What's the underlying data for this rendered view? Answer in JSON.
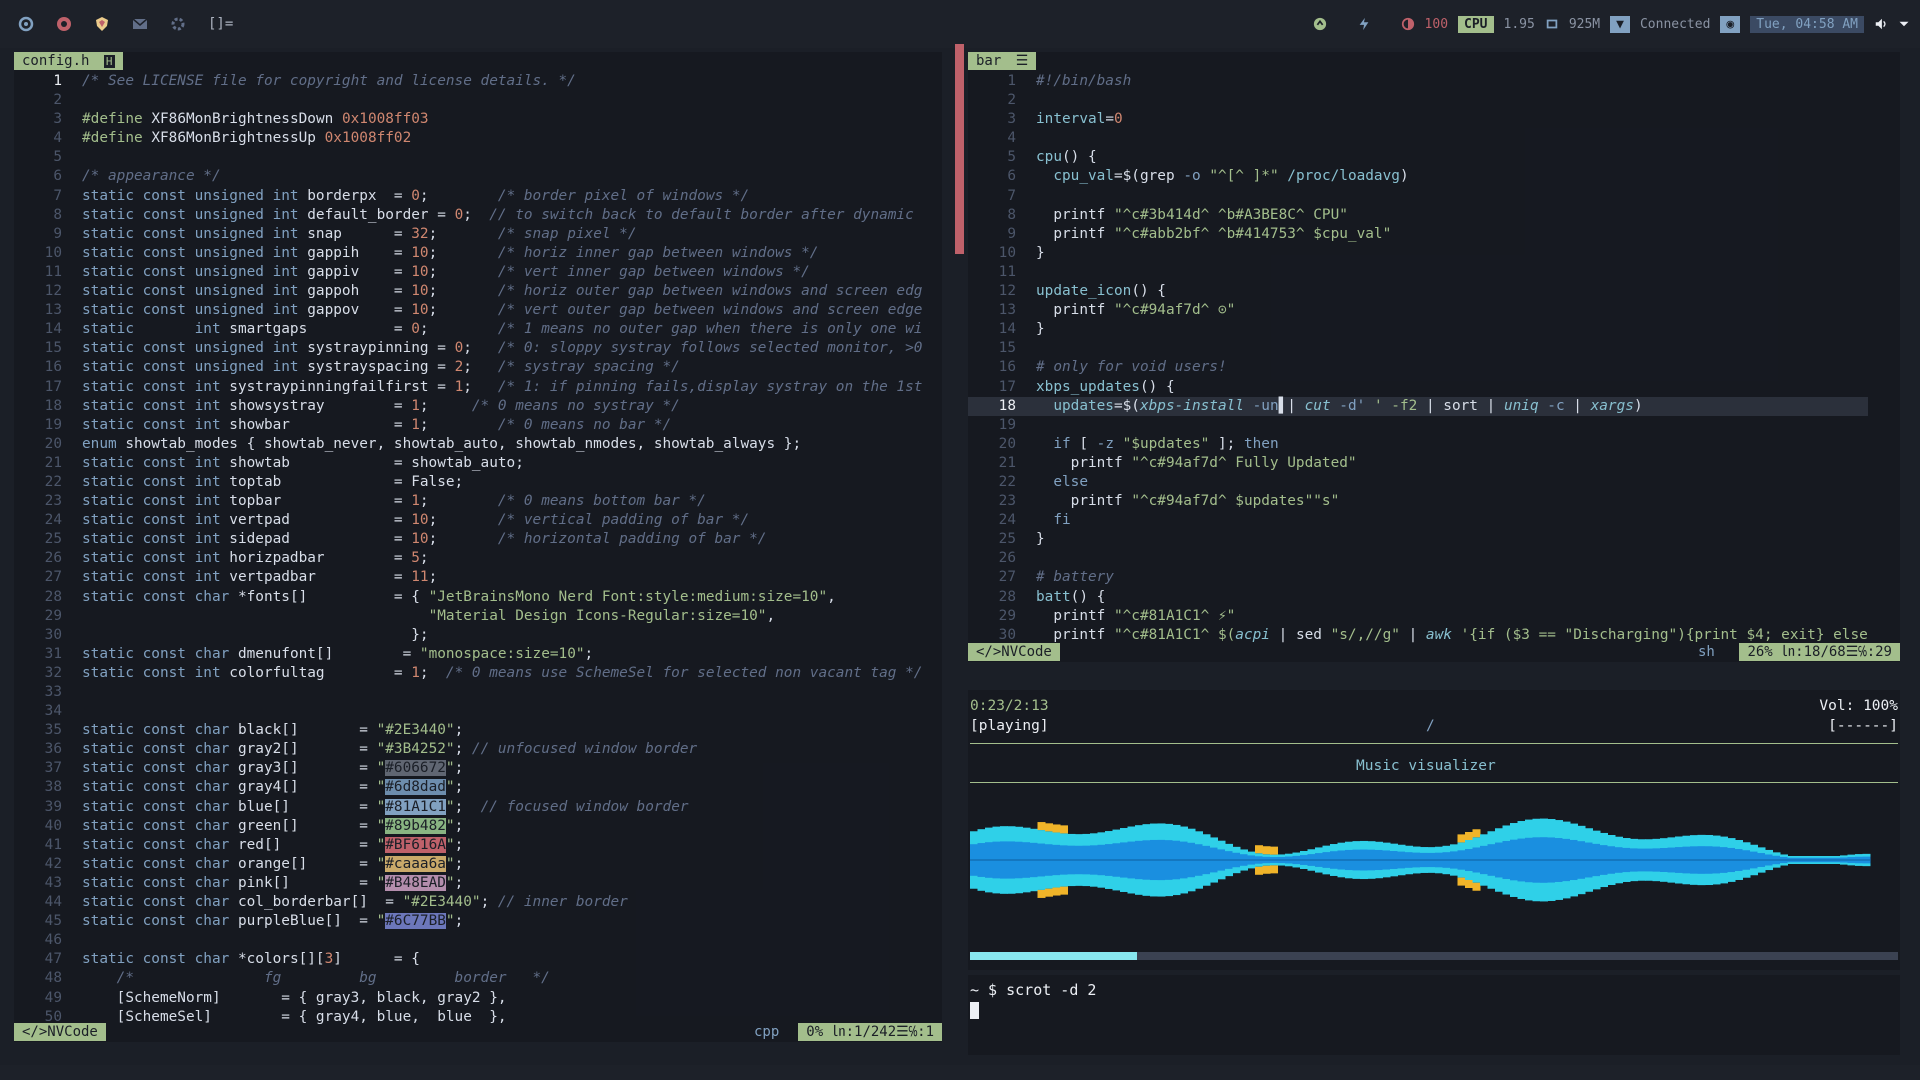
{
  "topbar": {
    "cpu_label": "CPU",
    "cpu_value": "1.95",
    "mem_value": "925M",
    "brightness_value": "100",
    "wifi_status": "Connected",
    "datetime": "Tue, 04:58 AM",
    "bracket": "[]="
  },
  "left_editor": {
    "tab": "config.h",
    "status_mode": "</>NVCode",
    "filetype": "cpp",
    "position": "0% ㏑:1/242☰℅:1",
    "lines": [
      {
        "n": "1",
        "html": "<span class='cm'>/* See LICENSE file for copyright and license details. */</span>"
      },
      {
        "n": "2",
        "html": ""
      },
      {
        "n": "3",
        "html": "<span class='pp'>#define</span> <span class='id'>XF86MonBrightnessDown</span> <span class='num'>0x1008ff03</span>"
      },
      {
        "n": "4",
        "html": "<span class='pp'>#define</span> <span class='id'>XF86MonBrightnessUp</span> <span class='num'>0x1008ff02</span>"
      },
      {
        "n": "5",
        "html": ""
      },
      {
        "n": "6",
        "html": "<span class='cm'>/* appearance */</span>"
      },
      {
        "n": "7",
        "html": "<span class='kw'>static const unsigned int</span> borderpx  = <span class='num'>0</span>;        <span class='cm'>/* border pixel of windows */</span>"
      },
      {
        "n": "8",
        "html": "<span class='kw'>static const unsigned int</span> default_border = <span class='num'>0</span>;  <span class='cm'>// to switch back to default border after dynamic</span>"
      },
      {
        "n": "9",
        "html": "<span class='kw'>static const unsigned int</span> snap      = <span class='num'>32</span>;       <span class='cm'>/* snap pixel */</span>"
      },
      {
        "n": "10",
        "html": "<span class='kw'>static const unsigned int</span> gappih    = <span class='num'>10</span>;       <span class='cm'>/* horiz inner gap between windows */</span>"
      },
      {
        "n": "11",
        "html": "<span class='kw'>static const unsigned int</span> gappiv    = <span class='num'>10</span>;       <span class='cm'>/* vert inner gap between windows */</span>"
      },
      {
        "n": "12",
        "html": "<span class='kw'>static const unsigned int</span> gappoh    = <span class='num'>10</span>;       <span class='cm'>/* horiz outer gap between windows and screen edg</span>"
      },
      {
        "n": "13",
        "html": "<span class='kw'>static const unsigned int</span> gappov    = <span class='num'>10</span>;       <span class='cm'>/* vert outer gap between windows and screen edge</span>"
      },
      {
        "n": "14",
        "html": "<span class='kw'>static       int</span> smartgaps          = <span class='num'>0</span>;        <span class='cm'>/* 1 means no outer gap when there is only one wi</span>"
      },
      {
        "n": "15",
        "html": "<span class='kw'>static const unsigned int</span> systraypinning = <span class='num'>0</span>;   <span class='cm'>/* 0: sloppy systray follows selected monitor, >0</span>"
      },
      {
        "n": "16",
        "html": "<span class='kw'>static const unsigned int</span> systrayspacing = <span class='num'>2</span>;   <span class='cm'>/* systray spacing */</span>"
      },
      {
        "n": "17",
        "html": "<span class='kw'>static const int</span> systraypinningfailfirst = <span class='num'>1</span>;   <span class='cm'>/* 1: if pinning fails,display systray on the 1st</span>"
      },
      {
        "n": "18",
        "html": "<span class='kw'>static const int</span> showsystray        = <span class='num'>1</span>;     <span class='cm'>/* 0 means no systray */</span>"
      },
      {
        "n": "19",
        "html": "<span class='kw'>static const int</span> showbar            = <span class='num'>1</span>;        <span class='cm'>/* 0 means no bar */</span>"
      },
      {
        "n": "20",
        "html": "<span class='kw'>enum</span> showtab_modes { showtab_never, showtab_auto, showtab_nmodes, showtab_always };"
      },
      {
        "n": "21",
        "html": "<span class='kw'>static const int</span> showtab            = showtab_auto;"
      },
      {
        "n": "22",
        "html": "<span class='kw'>static const int</span> toptab             = False;"
      },
      {
        "n": "23",
        "html": "<span class='kw'>static const int</span> topbar             = <span class='num'>1</span>;        <span class='cm'>/* 0 means bottom bar */</span>"
      },
      {
        "n": "24",
        "html": "<span class='kw'>static const int</span> vertpad            = <span class='num'>10</span>;       <span class='cm'>/* vertical padding of bar */</span>"
      },
      {
        "n": "25",
        "html": "<span class='kw'>static const int</span> sidepad            = <span class='num'>10</span>;       <span class='cm'>/* horizontal padding of bar */</span>"
      },
      {
        "n": "26",
        "html": "<span class='kw'>static const int</span> horizpadbar        = <span class='num'>5</span>;"
      },
      {
        "n": "27",
        "html": "<span class='kw'>static const int</span> vertpadbar         = <span class='num'>11</span>;"
      },
      {
        "n": "28",
        "html": "<span class='kw'>static const char</span> *fonts[]          = { <span class='str'>\"JetBrainsMono Nerd Font:style:medium:size=10\"</span>,"
      },
      {
        "n": "29",
        "html": "                                        <span class='str'>\"Material Design Icons-Regular:size=10\"</span>,"
      },
      {
        "n": "30",
        "html": "                                      };"
      },
      {
        "n": "31",
        "html": "<span class='kw'>static const char</span> dmenufont[]        = <span class='str'>\"monospace:size=10\"</span>;"
      },
      {
        "n": "32",
        "html": "<span class='kw'>static const int</span> colorfultag        = <span class='num'>1</span>;  <span class='cm'>/* 0 means use SchemeSel for selected non vacant tag */</span>"
      },
      {
        "n": "33",
        "html": ""
      },
      {
        "n": "34",
        "html": ""
      },
      {
        "n": "35",
        "html": "<span class='kw'>static const char</span> black[]       = <span class='str'>\"#2E3440\"</span>;"
      },
      {
        "n": "36",
        "html": "<span class='kw'>static const char</span> gray2[]       = <span class='str'>\"#3B4252\"</span>; <span class='cm'>// unfocused window border</span>"
      },
      {
        "n": "37",
        "html": "<span class='kw'>static const char</span> gray3[]       = <span class='str'>\"<span style='background:#606672;color:#1b1f27'>#606672</span>\"</span>;"
      },
      {
        "n": "38",
        "html": "<span class='kw'>static const char</span> gray4[]       = <span class='str'>\"<span style='background:#6d8dad;color:#1b1f27'>#6d8dad</span>\"</span>;"
      },
      {
        "n": "39",
        "html": "<span class='kw'>static const char</span> blue[]        = <span class='str'>\"<span style='background:#81A1C1;color:#1b1f27'>#81A1C1</span>\"</span>;  <span class='cm'>// focused window border</span>"
      },
      {
        "n": "40",
        "html": "<span class='kw'>static const char</span> green[]       = <span class='str'>\"<span style='background:#89b482;color:#1b1f27'>#89b482</span>\"</span>;"
      },
      {
        "n": "41",
        "html": "<span class='kw'>static const char</span> red[]         = <span class='str'>\"<span style='background:#BF616A;color:#1b1f27'>#BF616A</span>\"</span>;"
      },
      {
        "n": "42",
        "html": "<span class='kw'>static const char</span> orange[]      = <span class='str'>\"<span style='background:#caaa6a;color:#1b1f27'>#caaa6a</span>\"</span>;"
      },
      {
        "n": "43",
        "html": "<span class='kw'>static const char</span> pink[]        = <span class='str'>\"<span style='background:#B48EAD;color:#1b1f27'>#B48EAD</span>\"</span>;"
      },
      {
        "n": "44",
        "html": "<span class='kw'>static const char</span> col_borderbar[]  = <span class='str'>\"#2E3440\"</span>; <span class='cm'>// inner border</span>"
      },
      {
        "n": "45",
        "html": "<span class='kw'>static const char</span> purpleBlue[]  = <span class='str'>\"<span style='background:#6C77BB;color:#1b1f27'>#6C77BB</span>\"</span>;"
      },
      {
        "n": "46",
        "html": ""
      },
      {
        "n": "47",
        "html": "<span class='kw'>static const char</span> *colors[][<span class='num'>3</span>]      = {"
      },
      {
        "n": "48",
        "html": "    <span class='cm'>/*               fg         bg         border   */</span>"
      },
      {
        "n": "49",
        "html": "    [SchemeNorm]       = { gray3, black, gray2 },"
      },
      {
        "n": "50",
        "html": "    [SchemeSel]        = { gray4, blue,  blue  },"
      }
    ]
  },
  "right_editor": {
    "tab": "bar",
    "status_mode": "</>NVCode",
    "filetype": "sh",
    "position": "26% ㏑:18/68☰℅:29",
    "lines": [
      {
        "n": "1",
        "html": "<span class='cm'>#!/bin/bash</span>"
      },
      {
        "n": "2",
        "html": ""
      },
      {
        "n": "3",
        "html": "<span class='fn'>interval</span>=<span class='num'>0</span>"
      },
      {
        "n": "4",
        "html": ""
      },
      {
        "n": "5",
        "html": "<span class='fn'>cpu</span>() {"
      },
      {
        "n": "6",
        "html": "  <span class='fn'>cpu_val</span>=$(<span class='id'>grep</span> <span class='op'>-o</span> <span class='str'>\"^[^ ]*\"</span> <span class='fn'>/proc/loadavg</span>)"
      },
      {
        "n": "7",
        "html": ""
      },
      {
        "n": "8",
        "html": "  <span class='id'>printf</span> <span class='str'>\"^c#3b414d^ ^b#A3BE8C^ CPU\"</span>"
      },
      {
        "n": "9",
        "html": "  <span class='id'>printf</span> <span class='str'>\"^c#abb2bf^ ^b#414753^ $cpu_val\"</span>"
      },
      {
        "n": "10",
        "html": "}"
      },
      {
        "n": "11",
        "html": ""
      },
      {
        "n": "12",
        "html": "<span class='fn'>update_icon</span>() {"
      },
      {
        "n": "13",
        "html": "  <span class='id'>printf</span> <span class='str'>\"^c#94af7d^ ⊙\"</span>"
      },
      {
        "n": "14",
        "html": "}"
      },
      {
        "n": "15",
        "html": ""
      },
      {
        "n": "16",
        "html": "<span class='cm'># only for void users!</span>"
      },
      {
        "n": "17",
        "html": "<span class='fn'>xbps_updates</span>() {"
      },
      {
        "n": "18",
        "html": "  <span class='fn'>updates</span>=$(<span class='fn' style='font-style:italic'>xbps-install</span> <span class='op'>-un</span>▌| <span class='fn' style='font-style:italic'>cut</span> <span class='op'>-d'</span> <span class='str'>' -f2</span> | <span class='id'>sort</span> | <span class='fn' style='font-style:italic'>uniq</span> <span class='op'>-c</span> | <span class='fn' style='font-style:italic'>xargs</span>)",
        "cur": true
      },
      {
        "n": "19",
        "html": ""
      },
      {
        "n": "20",
        "html": "  <span class='kw'>if</span> [ <span class='op'>-z</span> <span class='str'>\"$updates\"</span> ]; <span class='kw'>then</span>"
      },
      {
        "n": "21",
        "html": "    <span class='id'>printf</span> <span class='str'>\"^c#94af7d^ Fully Updated\"</span>"
      },
      {
        "n": "22",
        "html": "  <span class='kw'>else</span>"
      },
      {
        "n": "23",
        "html": "    <span class='id'>printf</span> <span class='str'>\"^c#94af7d^ $updates\"\"s\"</span>"
      },
      {
        "n": "24",
        "html": "  <span class='kw'>fi</span>"
      },
      {
        "n": "25",
        "html": "}"
      },
      {
        "n": "26",
        "html": ""
      },
      {
        "n": "27",
        "html": "<span class='cm'># battery</span>"
      },
      {
        "n": "28",
        "html": "<span class='fn'>batt</span>() {"
      },
      {
        "n": "29",
        "html": "  <span class='id'>printf</span> <span class='str'>\"^c#81A1C1^ ⚡\"</span>"
      },
      {
        "n": "30",
        "html": "  <span class='id'>printf</span> <span class='str'>\"^c#81A1C1^ $(</span><span class='fn' style='font-style:italic'>acpi</span> | <span class='id'>sed</span> <span class='str'>\"s/,//g\"</span> | <span class='fn' style='font-style:italic'>awk</span> <span class='str'>'{if ($3 == \"Discharging\"){print $4; exit} else</span>"
      }
    ]
  },
  "visualizer": {
    "time": "0:23/2:13",
    "state": "[playing]",
    "volume": "Vol: 100%",
    "slash": "/",
    "flags": "[------]",
    "title": "Music visualizer",
    "progress": 0.18
  },
  "terminal": {
    "prompt": "~ $",
    "command": "scrot -d 2"
  }
}
